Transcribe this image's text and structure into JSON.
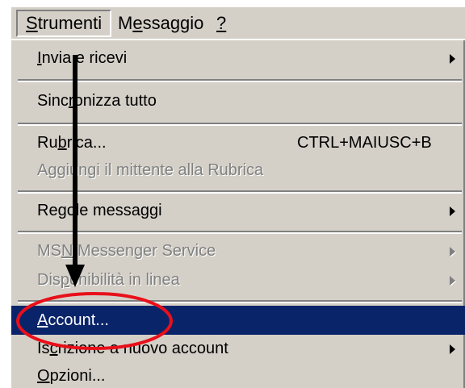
{
  "menubar": {
    "items": [
      {
        "pre": "",
        "accel": "S",
        "post": "trumenti"
      },
      {
        "pre": "M",
        "accel": "e",
        "post": "ssaggio"
      },
      {
        "pre": "",
        "accel": "?",
        "post": ""
      }
    ]
  },
  "menu": {
    "items": [
      {
        "pre": "",
        "accel": "I",
        "post": "nvia e ricevi",
        "shortcut": "",
        "submenu": true,
        "disabled": false
      },
      {
        "pre": "Sinc",
        "accel": "r",
        "post": "onizza tutto",
        "shortcut": "",
        "submenu": false,
        "disabled": false
      },
      {
        "pre": "Ru",
        "accel": "b",
        "post": "rica...",
        "shortcut": "CTRL+MAIUSC+B",
        "submenu": false,
        "disabled": false
      },
      {
        "pre": "A",
        "accel": "g",
        "post": "giungi il mittente alla Rubrica",
        "shortcut": "",
        "submenu": false,
        "disabled": true
      },
      {
        "pre": "Re",
        "accel": "g",
        "post": "ole messaggi",
        "shortcut": "",
        "submenu": true,
        "disabled": false
      },
      {
        "pre": "MS",
        "accel": "N",
        "post": " Messenger Service",
        "shortcut": "",
        "submenu": true,
        "disabled": true
      },
      {
        "pre": "Dis",
        "accel": "p",
        "post": "onibilità in linea",
        "shortcut": "",
        "submenu": true,
        "disabled": true
      },
      {
        "pre": "",
        "accel": "A",
        "post": "ccount...",
        "shortcut": "",
        "submenu": false,
        "disabled": false,
        "highlighted": true
      },
      {
        "pre": "Is",
        "accel": "c",
        "post": "rizione a nuovo account",
        "shortcut": "",
        "submenu": true,
        "disabled": false
      },
      {
        "pre": "",
        "accel": "O",
        "post": "pzioni...",
        "shortcut": "",
        "submenu": false,
        "disabled": false
      }
    ]
  },
  "colors": {
    "menu_bg": "#d4d0c8",
    "highlight_bg": "#0a246a",
    "annotation_circle": "#e8101a",
    "annotation_arrow": "#000000"
  }
}
